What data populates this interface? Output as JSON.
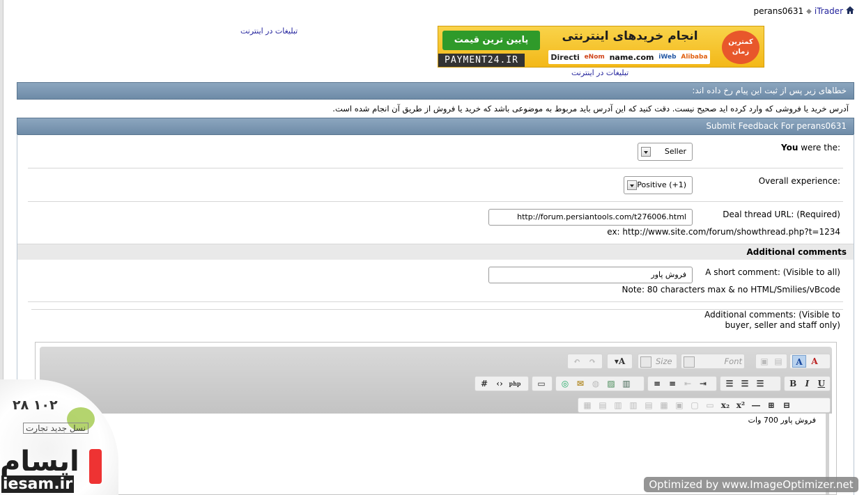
{
  "breadcrumb": {
    "home_icon": "home-icon",
    "site": "iTrader",
    "user": "perans0631"
  },
  "ads": {
    "link_top": "تبلیغات در اینترنت",
    "link_bottom": "تبلیغات در اینترنت",
    "banner": {
      "price_text": "پایین ترین قیمت",
      "title": "انجام خریدهای اینترنتی",
      "logos": [
        "Directi",
        "eNom",
        "name.com",
        "iWeb",
        "Alibaba"
      ],
      "brand": "PAYMENT24.IR",
      "side_text": "کمترین زمان"
    }
  },
  "errors": {
    "header": "خطاهای زیر پس از ثبت این پیام رخ داده اند:",
    "message": "آدرس خرید یا فروشی که وارد کرده اید صحیح نیست. دقت کنید که این آدرس باید مربوط به موضوعی باشد که خرید یا فروش از طریق آن انجام شده است."
  },
  "form": {
    "title": "Submit Feedback For perans0631",
    "role": {
      "label_pre": "You",
      "label_post": " were the:",
      "value": "Seller"
    },
    "experience": {
      "label": "Overall experience:",
      "value": "Positive (+1)"
    },
    "deal_url": {
      "label": "Deal thread URL: (Required)",
      "value": "http://forum.persiantools.com/t276006.html",
      "hint": "ex: http://www.site.com/forum/showthread.php?t=1234"
    },
    "section_title": "Additional comments",
    "short_comment": {
      "label": "A short comment: (Visible to all)",
      "value": "فروش پاور",
      "note": "Note: 80 characters max & no HTML/Smilies/vBcode"
    },
    "additional": {
      "label": "Additional comments: (Visible to buyer, seller and staff only)"
    }
  },
  "editor": {
    "font_placeholder": "Font",
    "size_placeholder": "Size",
    "content": "فروش پاور 700 وات"
  },
  "watermark": {
    "number": "۲۸ ۱۰۲",
    "tagline": "نسل جدید تجارت",
    "logo": "ایسام",
    "url": "iesam.ir"
  },
  "optimizer": "Optimized by www.ImageOptimizer.net"
}
